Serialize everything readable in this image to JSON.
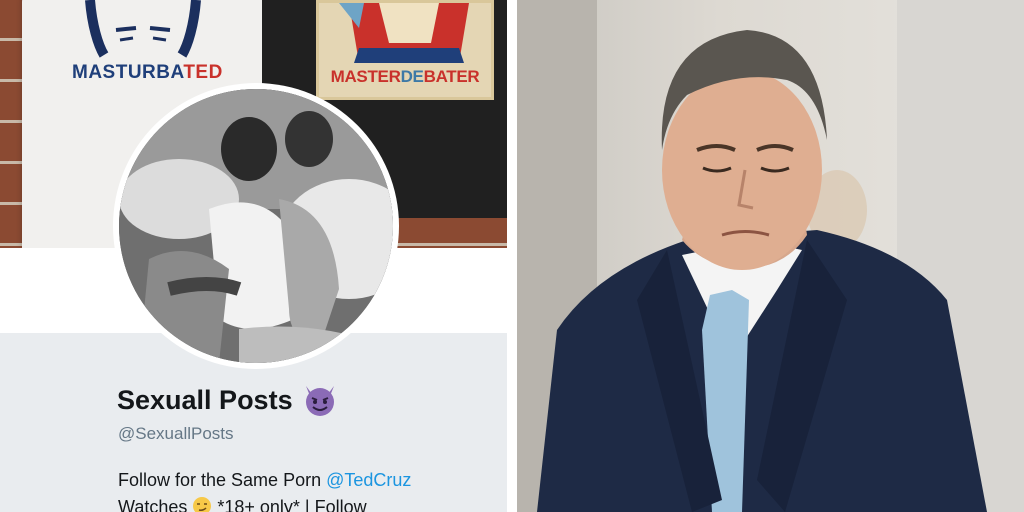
{
  "banner": {
    "shirt_white_text_blue": "MASTURBA",
    "shirt_white_text_red": "TED",
    "poster_text_red_1": "MASTER",
    "poster_text_blue": "DE",
    "poster_text_red_2": "BATER"
  },
  "profile": {
    "display_name": "Sexuall Posts",
    "handle": "@SexuallPosts",
    "bio": {
      "part1": "Follow for the Same Porn ",
      "mention": "@TedCruz",
      "part2": "Watches ",
      "part3": " *18+ only* | Follow"
    }
  },
  "icons": {
    "name_emoji": "smiling-face-with-horns-icon",
    "bio_emoji": "smirking-face-icon"
  },
  "colors": {
    "name_text": "#14171a",
    "handle_text": "#657786",
    "link": "#1b95e0",
    "card_bg": "#e9ecef",
    "emoji_purple": "#8b6bb6"
  }
}
